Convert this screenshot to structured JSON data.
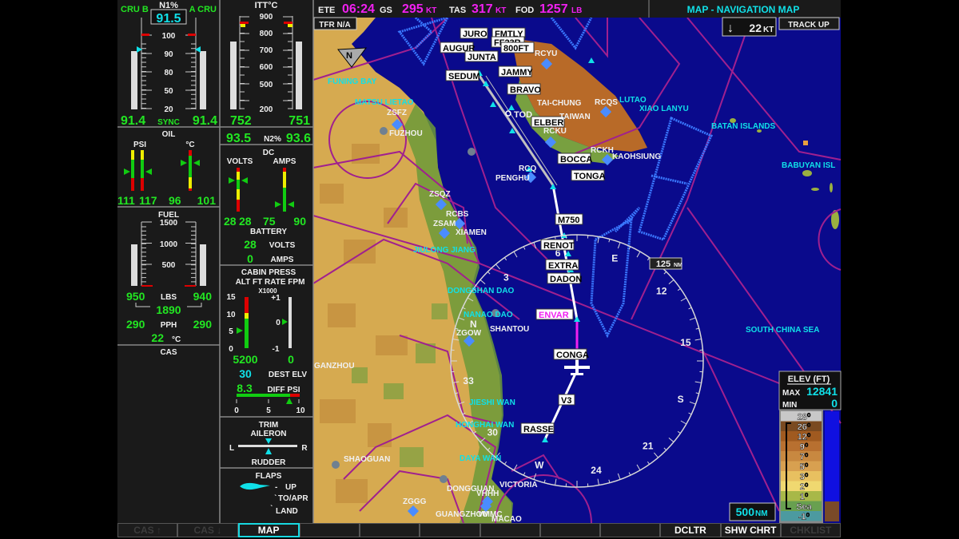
{
  "top_bar": {
    "ete_label": "ETE",
    "ete": "06:24",
    "gs_label": "GS",
    "gs": "295",
    "gs_unit": "KT",
    "tas_label": "TAS",
    "tas": "317",
    "tas_unit": "KT",
    "fod_label": "FOD",
    "fod": "1257",
    "fod_unit": "LB",
    "page_title": "MAP - NAVIGATION MAP"
  },
  "eis": {
    "n1": {
      "title": "N1%",
      "left_mode": "CRU B",
      "right_mode": "A CRU",
      "target": "91.5",
      "scale": [
        "100",
        "90",
        "80",
        "50",
        "20"
      ],
      "left": "91.4",
      "right": "91.4",
      "sync": "SYNC"
    },
    "itt": {
      "title": "ITT°C",
      "scale": [
        "900",
        "800",
        "700",
        "600",
        "500",
        "200"
      ],
      "left": "752",
      "right": "751"
    },
    "n2": {
      "label": "N2%",
      "left": "93.5",
      "right": "93.6"
    },
    "oil": {
      "title": "OIL",
      "psi_label": "PSI",
      "temp_label": "°C",
      "psi_left": "111",
      "psi_right": "117",
      "temp_left": "96",
      "temp_right": "101"
    },
    "dc": {
      "title": "DC",
      "volts_label": "VOLTS",
      "amps_label": "AMPS",
      "volts_left": "28",
      "volts_right": "28",
      "amps_left": "75",
      "amps_right": "90",
      "battery_label": "BATTERY",
      "battery_volts": "28",
      "battery_volts_unit": "VOLTS",
      "battery_amps": "0",
      "battery_amps_unit": "AMPS"
    },
    "fuel": {
      "title": "FUEL",
      "scale": [
        "1500",
        "1000",
        "500"
      ],
      "left": "950",
      "right": "940",
      "qty_unit": "LBS",
      "total": "1890",
      "flow_left": "290",
      "flow_right": "290",
      "flow_unit": "PPH",
      "temp": "22",
      "temp_unit": "°C"
    },
    "cas": {
      "title": "CAS"
    },
    "cabin": {
      "title": "CABIN PRESS",
      "subtitle": "ALT FT RATE FPM",
      "multiplier": "X1000",
      "alt_scale": [
        "15",
        "10",
        "5",
        "0"
      ],
      "rate_scale": [
        "+1",
        "0",
        "-1"
      ],
      "alt": "5200",
      "rate": "0",
      "dest_elv": "30",
      "dest_elv_label": "DEST ELV",
      "diff_psi": "8.3",
      "diff_psi_label": "DIFF PSI",
      "diff_scale": [
        "0",
        "5",
        "10"
      ]
    },
    "trim": {
      "title": "TRIM",
      "aileron": "AILERON",
      "left": "L",
      "right": "R",
      "rudder": "RUDDER"
    },
    "flaps": {
      "title": "FLAPS",
      "up": "UP",
      "to_apr": "TO/APR",
      "land": "LAND",
      "position": "UP"
    }
  },
  "map": {
    "tfr": "TFR N/A",
    "wind": {
      "speed": "22",
      "unit": "KT",
      "icon": "wind-arrow-down-icon"
    },
    "orientation_button": "TRACK UP",
    "ring_range": "125",
    "ring_range_unit": "NM",
    "map_range": "500",
    "map_range_unit": "NM",
    "north_icon": "north-arrow-icon",
    "compass": {
      "N": "N",
      "E": "E",
      "S": "S",
      "W": "W",
      "3": "3",
      "6": "6",
      "12": "12",
      "15": "15",
      "21": "21",
      "24": "24",
      "30": "30",
      "33": "33"
    },
    "waypoints": [
      "JURO",
      "FMTLY",
      "FF23R",
      "AUGUR",
      "800FT",
      "JUNTA",
      "SEDUM",
      "JAMMY",
      "BRAVO",
      "ELBER",
      "BOCCA",
      "TONGA",
      "M750",
      "RENOT",
      "EXTRA",
      "DADON",
      "CONGA",
      "V3",
      "RASSE"
    ],
    "active_waypoint": "ENVAR",
    "tod": "TOD",
    "airports": [
      "RCYU",
      "RCQS",
      "ZSFZ",
      "RCKH",
      "RCQ",
      "ZSQZ",
      "RCBS",
      "ZSAM",
      "ZGOW",
      "ZGGG",
      "VHHH",
      "VMMC",
      "RCKU"
    ],
    "cities": [
      "FUZHOU",
      "KAOHSIUNG",
      "XIAMEN",
      "SHANTOU",
      "GANZHOU",
      "SHAOGUAN",
      "DONGGUAN",
      "VICTORIA",
      "GUANGZHOU",
      "MACAO",
      "TAI-CHUNG",
      "TAIWAN",
      "PENGHU"
    ],
    "water": [
      "FUNING BAY",
      "MATSU LIETAO",
      "JIULONG JIANG",
      "DONGSHAN DAO",
      "NANAO DAO",
      "JIESHI WAN",
      "HONGHAI WAN",
      "DAYA WAN",
      "XIAO LANYU",
      "BATAN ISLANDS",
      "BABUYAN ISL",
      "SOUTH CHINA SEA",
      "LUTAO"
    ],
    "elevation": {
      "title": "ELEV (FT)",
      "max_label": "MAX",
      "max": "12841",
      "min_label": "MIN",
      "min": "0",
      "legend": [
        "28⁰",
        "26⁰",
        "12⁰",
        "9⁰",
        "7⁰",
        "5⁰",
        "3⁰",
        "2⁰",
        "1⁰",
        "Sea",
        "-1⁰"
      ]
    }
  },
  "softkeys": [
    {
      "label": "CAS ↑",
      "state": "disabled"
    },
    {
      "label": "CAS ↓",
      "state": "disabled"
    },
    {
      "label": "MAP",
      "state": "active"
    },
    {
      "label": "",
      "state": "normal"
    },
    {
      "label": "",
      "state": "normal"
    },
    {
      "label": "",
      "state": "normal"
    },
    {
      "label": "",
      "state": "normal"
    },
    {
      "label": "",
      "state": "normal"
    },
    {
      "label": "",
      "state": "normal"
    },
    {
      "label": "DCLTR",
      "state": "normal"
    },
    {
      "label": "SHW CHRT",
      "state": "normal"
    },
    {
      "label": "CHKLIST",
      "state": "disabled"
    }
  ],
  "colors": {
    "map_water": "#0a0a8c",
    "land": "#d6aa50",
    "coast_green": "#6c9a38",
    "airspace": "#a0208f",
    "restricted": "#3a78ff",
    "engine_value": "#22e622",
    "cyan": "#10e0e8",
    "magenta": "#f020f0"
  }
}
